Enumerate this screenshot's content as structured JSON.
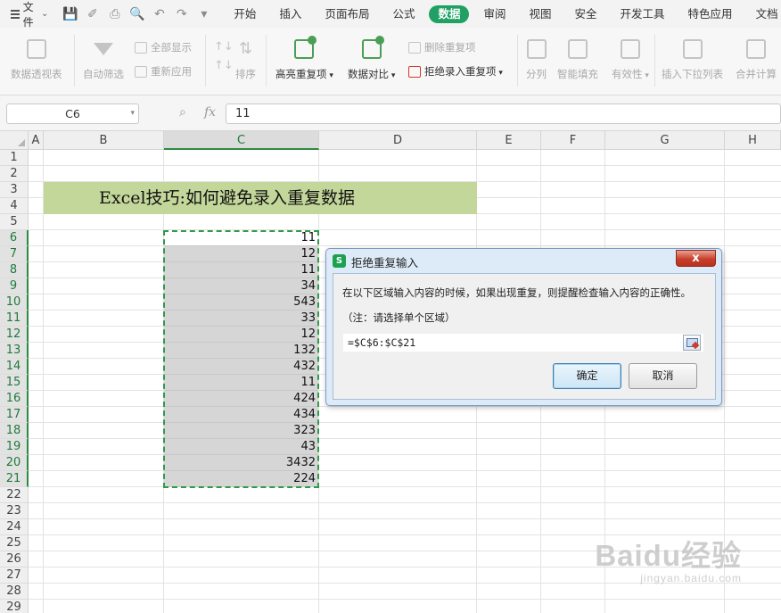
{
  "menubar": {
    "file_label": "文件",
    "tabs": [
      {
        "label": "开始"
      },
      {
        "label": "插入"
      },
      {
        "label": "页面布局"
      },
      {
        "label": "公式"
      },
      {
        "label": "数据",
        "active": true
      },
      {
        "label": "审阅"
      },
      {
        "label": "视图"
      },
      {
        "label": "安全"
      },
      {
        "label": "开发工具"
      },
      {
        "label": "特色应用"
      },
      {
        "label": "文档"
      }
    ],
    "active_color": "#20a163"
  },
  "ribbon": {
    "pivot": "数据透视表",
    "auto_filter": "自动筛选",
    "show_all": "全部显示",
    "reapply": "重新应用",
    "sort": "排序",
    "highlight_dup": "高亮重复项",
    "data_compare": "数据对比",
    "remove_dup": "删除重复项",
    "reject_dup": "拒绝录入重复项",
    "split": "分列",
    "smart_fill": "智能填充",
    "validity": "有效性",
    "insert_dropdown": "插入下拉列表",
    "merge_calc": "合并计算"
  },
  "formula_bar": {
    "name_box": "C6",
    "fx": "fx",
    "value": "11"
  },
  "sheet": {
    "columns": [
      "A",
      "B",
      "C",
      "D",
      "E",
      "F",
      "G",
      "H"
    ],
    "rows": [
      "1",
      "2",
      "3",
      "4",
      "5",
      "6",
      "7",
      "8",
      "9",
      "10",
      "11",
      "12",
      "13",
      "14",
      "15",
      "16",
      "17",
      "18",
      "19",
      "20",
      "21",
      "22",
      "23",
      "24",
      "25",
      "26",
      "27",
      "28",
      "29"
    ],
    "title": "Excel技巧:如何避免录入重复数据",
    "title_bg": "#c4d79b",
    "selection_color": "#2f9a47",
    "column_c_values": [
      "11",
      "12",
      "11",
      "34",
      "543",
      "33",
      "12",
      "132",
      "432",
      "11",
      "424",
      "434",
      "323",
      "43",
      "3432",
      "224"
    ]
  },
  "dialog": {
    "title": "拒绝重复输入",
    "logo": "S",
    "close": "x",
    "message": "在以下区域输入内容的时候，如果出现重复，则提醒检查输入内容的正确性。",
    "note": "（注：请选择单个区域）",
    "range": "=$C$6:$C$21",
    "ok_label": "确定",
    "cancel_label": "取消"
  },
  "watermark": {
    "main": "Baidu经验",
    "sub": "jingyan.baidu.com"
  }
}
